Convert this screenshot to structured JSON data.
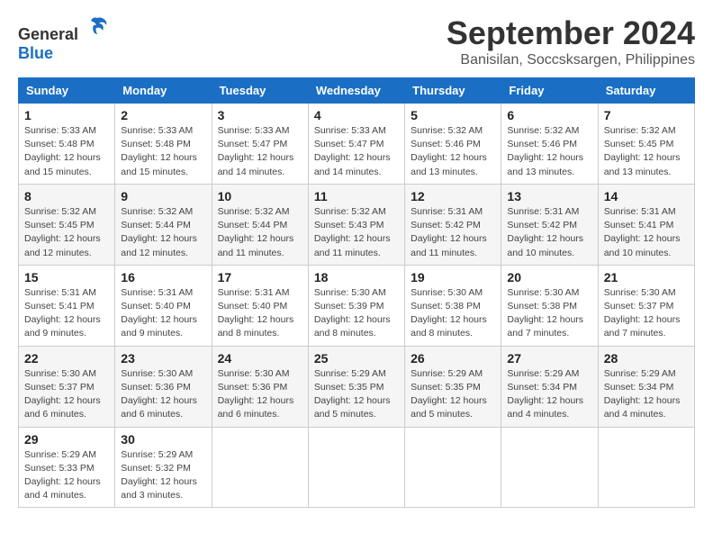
{
  "header": {
    "logo_general": "General",
    "logo_blue": "Blue",
    "title": "September 2024",
    "subtitle": "Banisilan, Soccsksargen, Philippines"
  },
  "weekdays": [
    "Sunday",
    "Monday",
    "Tuesday",
    "Wednesday",
    "Thursday",
    "Friday",
    "Saturday"
  ],
  "weeks": [
    [
      {
        "day": "1",
        "detail": "Sunrise: 5:33 AM\nSunset: 5:48 PM\nDaylight: 12 hours\nand 15 minutes."
      },
      {
        "day": "2",
        "detail": "Sunrise: 5:33 AM\nSunset: 5:48 PM\nDaylight: 12 hours\nand 15 minutes."
      },
      {
        "day": "3",
        "detail": "Sunrise: 5:33 AM\nSunset: 5:47 PM\nDaylight: 12 hours\nand 14 minutes."
      },
      {
        "day": "4",
        "detail": "Sunrise: 5:33 AM\nSunset: 5:47 PM\nDaylight: 12 hours\nand 14 minutes."
      },
      {
        "day": "5",
        "detail": "Sunrise: 5:32 AM\nSunset: 5:46 PM\nDaylight: 12 hours\nand 13 minutes."
      },
      {
        "day": "6",
        "detail": "Sunrise: 5:32 AM\nSunset: 5:46 PM\nDaylight: 12 hours\nand 13 minutes."
      },
      {
        "day": "7",
        "detail": "Sunrise: 5:32 AM\nSunset: 5:45 PM\nDaylight: 12 hours\nand 13 minutes."
      }
    ],
    [
      {
        "day": "8",
        "detail": "Sunrise: 5:32 AM\nSunset: 5:45 PM\nDaylight: 12 hours\nand 12 minutes."
      },
      {
        "day": "9",
        "detail": "Sunrise: 5:32 AM\nSunset: 5:44 PM\nDaylight: 12 hours\nand 12 minutes."
      },
      {
        "day": "10",
        "detail": "Sunrise: 5:32 AM\nSunset: 5:44 PM\nDaylight: 12 hours\nand 11 minutes."
      },
      {
        "day": "11",
        "detail": "Sunrise: 5:32 AM\nSunset: 5:43 PM\nDaylight: 12 hours\nand 11 minutes."
      },
      {
        "day": "12",
        "detail": "Sunrise: 5:31 AM\nSunset: 5:42 PM\nDaylight: 12 hours\nand 11 minutes."
      },
      {
        "day": "13",
        "detail": "Sunrise: 5:31 AM\nSunset: 5:42 PM\nDaylight: 12 hours\nand 10 minutes."
      },
      {
        "day": "14",
        "detail": "Sunrise: 5:31 AM\nSunset: 5:41 PM\nDaylight: 12 hours\nand 10 minutes."
      }
    ],
    [
      {
        "day": "15",
        "detail": "Sunrise: 5:31 AM\nSunset: 5:41 PM\nDaylight: 12 hours\nand 9 minutes."
      },
      {
        "day": "16",
        "detail": "Sunrise: 5:31 AM\nSunset: 5:40 PM\nDaylight: 12 hours\nand 9 minutes."
      },
      {
        "day": "17",
        "detail": "Sunrise: 5:31 AM\nSunset: 5:40 PM\nDaylight: 12 hours\nand 8 minutes."
      },
      {
        "day": "18",
        "detail": "Sunrise: 5:30 AM\nSunset: 5:39 PM\nDaylight: 12 hours\nand 8 minutes."
      },
      {
        "day": "19",
        "detail": "Sunrise: 5:30 AM\nSunset: 5:38 PM\nDaylight: 12 hours\nand 8 minutes."
      },
      {
        "day": "20",
        "detail": "Sunrise: 5:30 AM\nSunset: 5:38 PM\nDaylight: 12 hours\nand 7 minutes."
      },
      {
        "day": "21",
        "detail": "Sunrise: 5:30 AM\nSunset: 5:37 PM\nDaylight: 12 hours\nand 7 minutes."
      }
    ],
    [
      {
        "day": "22",
        "detail": "Sunrise: 5:30 AM\nSunset: 5:37 PM\nDaylight: 12 hours\nand 6 minutes."
      },
      {
        "day": "23",
        "detail": "Sunrise: 5:30 AM\nSunset: 5:36 PM\nDaylight: 12 hours\nand 6 minutes."
      },
      {
        "day": "24",
        "detail": "Sunrise: 5:30 AM\nSunset: 5:36 PM\nDaylight: 12 hours\nand 6 minutes."
      },
      {
        "day": "25",
        "detail": "Sunrise: 5:29 AM\nSunset: 5:35 PM\nDaylight: 12 hours\nand 5 minutes."
      },
      {
        "day": "26",
        "detail": "Sunrise: 5:29 AM\nSunset: 5:35 PM\nDaylight: 12 hours\nand 5 minutes."
      },
      {
        "day": "27",
        "detail": "Sunrise: 5:29 AM\nSunset: 5:34 PM\nDaylight: 12 hours\nand 4 minutes."
      },
      {
        "day": "28",
        "detail": "Sunrise: 5:29 AM\nSunset: 5:34 PM\nDaylight: 12 hours\nand 4 minutes."
      }
    ],
    [
      {
        "day": "29",
        "detail": "Sunrise: 5:29 AM\nSunset: 5:33 PM\nDaylight: 12 hours\nand 4 minutes."
      },
      {
        "day": "30",
        "detail": "Sunrise: 5:29 AM\nSunset: 5:32 PM\nDaylight: 12 hours\nand 3 minutes."
      },
      {
        "day": "",
        "detail": ""
      },
      {
        "day": "",
        "detail": ""
      },
      {
        "day": "",
        "detail": ""
      },
      {
        "day": "",
        "detail": ""
      },
      {
        "day": "",
        "detail": ""
      }
    ]
  ]
}
